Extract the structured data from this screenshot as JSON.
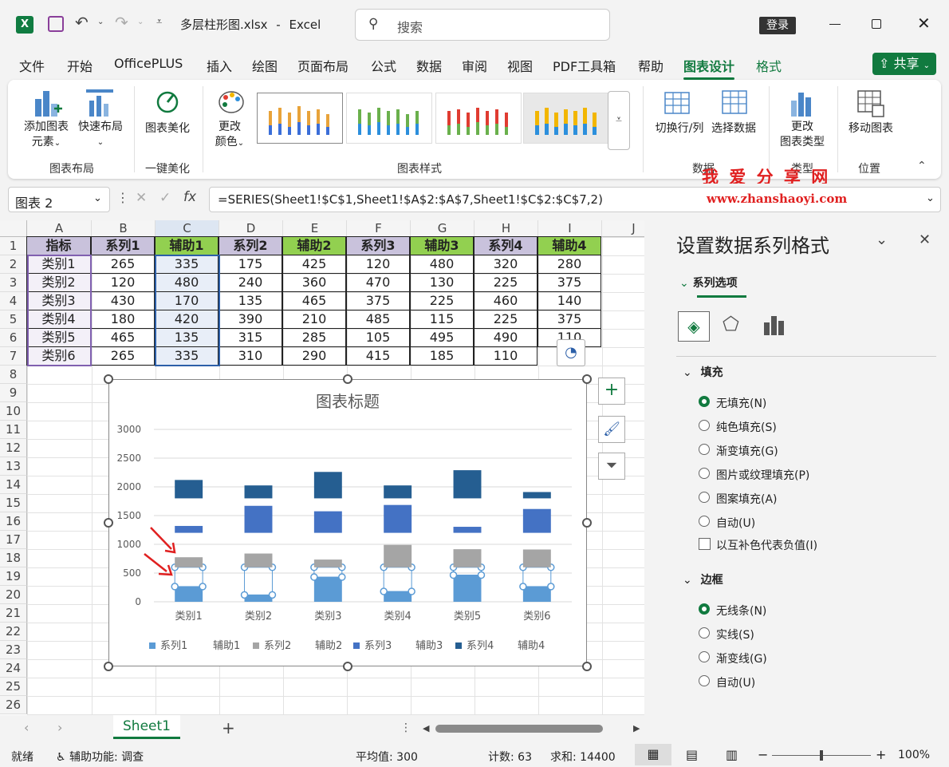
{
  "app": {
    "filename": "多层柱形图.xlsx",
    "separator": "-",
    "appname": "Excel",
    "search_placeholder": "搜索",
    "login_label": "登录",
    "share_label": "共享"
  },
  "menu": [
    "文件",
    "开始",
    "OfficePLUS",
    "插入",
    "绘图",
    "页面布局",
    "公式",
    "数据",
    "审阅",
    "视图",
    "PDF工具箱",
    "帮助",
    "图表设计",
    "格式"
  ],
  "ribbon": {
    "add_element_l1": "添加图表",
    "add_element_l2": "元素",
    "quick_layout": "快速布局",
    "chart_beautify": "图表美化",
    "change_color_l1": "更改",
    "change_color_l2": "颜色",
    "switch_rowcol": "切换行/列",
    "select_data": "选择数据",
    "change_type_l1": "更改",
    "change_type_l2": "图表类型",
    "move_chart": "移动图表",
    "groups": {
      "layout": "图表布局",
      "beautify": "一键美化",
      "styles": "图表样式",
      "data": "数据",
      "type": "类型",
      "location": "位置"
    }
  },
  "watermark": {
    "line1": "我 爱 分 享 网",
    "line2": "www.zhanshaoyi.com"
  },
  "formula": {
    "namebox": "图表 2",
    "fx": "fx",
    "text": "=SERIES(Sheet1!$C$1,Sheet1!$A$2:$A$7,Sheet1!$C$2:$C$7,2)"
  },
  "sheet": {
    "columns": [
      "A",
      "B",
      "C",
      "D",
      "E",
      "F",
      "G",
      "H",
      "I",
      "J"
    ],
    "rows": [
      "1",
      "2",
      "3",
      "4",
      "5",
      "6",
      "7",
      "8",
      "9",
      "10",
      "11",
      "12",
      "13",
      "14",
      "15",
      "16",
      "17",
      "18",
      "19",
      "20",
      "21",
      "22",
      "23",
      "24",
      "25",
      "26"
    ],
    "header": [
      "指标",
      "系列1",
      "辅助1",
      "系列2",
      "辅助2",
      "系列3",
      "辅助3",
      "系列4",
      "辅助4"
    ],
    "data": [
      [
        "类别1",
        "265",
        "335",
        "175",
        "425",
        "120",
        "480",
        "320",
        "280"
      ],
      [
        "类别2",
        "120",
        "480",
        "240",
        "360",
        "470",
        "130",
        "225",
        "375"
      ],
      [
        "类别3",
        "430",
        "170",
        "135",
        "465",
        "375",
        "225",
        "460",
        "140"
      ],
      [
        "类别4",
        "180",
        "420",
        "390",
        "210",
        "485",
        "115",
        "225",
        "375"
      ],
      [
        "类别5",
        "465",
        "135",
        "315",
        "285",
        "105",
        "495",
        "490",
        "110"
      ],
      [
        "类别6",
        "265",
        "335",
        "310",
        "290",
        "415",
        "185",
        "110",
        ""
      ]
    ],
    "tab": "Sheet1"
  },
  "chart_data": {
    "type": "bar",
    "title": "图表标题",
    "categories": [
      "类别1",
      "类别2",
      "类别3",
      "类别4",
      "类别5",
      "类别6"
    ],
    "ylim": [
      0,
      3000
    ],
    "yticks": [
      "0",
      "500",
      "1000",
      "1500",
      "2000",
      "2500",
      "3000"
    ],
    "stacked": true,
    "series": [
      {
        "name": "系列1",
        "color": "#5b9bd5",
        "values": [
          265,
          120,
          430,
          180,
          465,
          265
        ]
      },
      {
        "name": "辅助1",
        "color": "none",
        "values": [
          335,
          480,
          170,
          420,
          135,
          335
        ]
      },
      {
        "name": "系列2",
        "color": "#a5a5a5",
        "values": [
          175,
          240,
          135,
          390,
          315,
          310
        ]
      },
      {
        "name": "辅助2",
        "color": "none",
        "values": [
          425,
          360,
          465,
          210,
          285,
          290
        ]
      },
      {
        "name": "系列3",
        "color": "#4472c4",
        "values": [
          120,
          470,
          375,
          485,
          105,
          415
        ]
      },
      {
        "name": "辅助3",
        "color": "none",
        "values": [
          480,
          130,
          225,
          115,
          495,
          185
        ]
      },
      {
        "name": "系列4",
        "color": "#255e91",
        "values": [
          320,
          225,
          460,
          225,
          490,
          110
        ]
      },
      {
        "name": "辅助4",
        "color": "none",
        "values": [
          280,
          375,
          140,
          375,
          110,
          0
        ]
      }
    ],
    "legend_position": "bottom",
    "grid": true
  },
  "panel": {
    "title": "设置数据系列格式",
    "tab": "系列选项",
    "fill_header": "填充",
    "fill_options": [
      "无填充(N)",
      "纯色填充(S)",
      "渐变填充(G)",
      "图片或纹理填充(P)",
      "图案填充(A)",
      "自动(U)"
    ],
    "invert_label": "以互补色代表负值(I)",
    "border_header": "边框",
    "border_options": [
      "无线条(N)",
      "实线(S)",
      "渐变线(G)",
      "自动(U)"
    ]
  },
  "status": {
    "ready": "就绪",
    "accessibility": "辅助功能: 调查",
    "average": "平均值: 300",
    "count": "计数: 63",
    "sum": "求和: 14400",
    "zoom": "100%"
  },
  "colors": {
    "accent": "#117a3f",
    "header_purple": "#c9c2dc",
    "header_green": "#92d050",
    "selection_blue": "#e8eef8"
  }
}
